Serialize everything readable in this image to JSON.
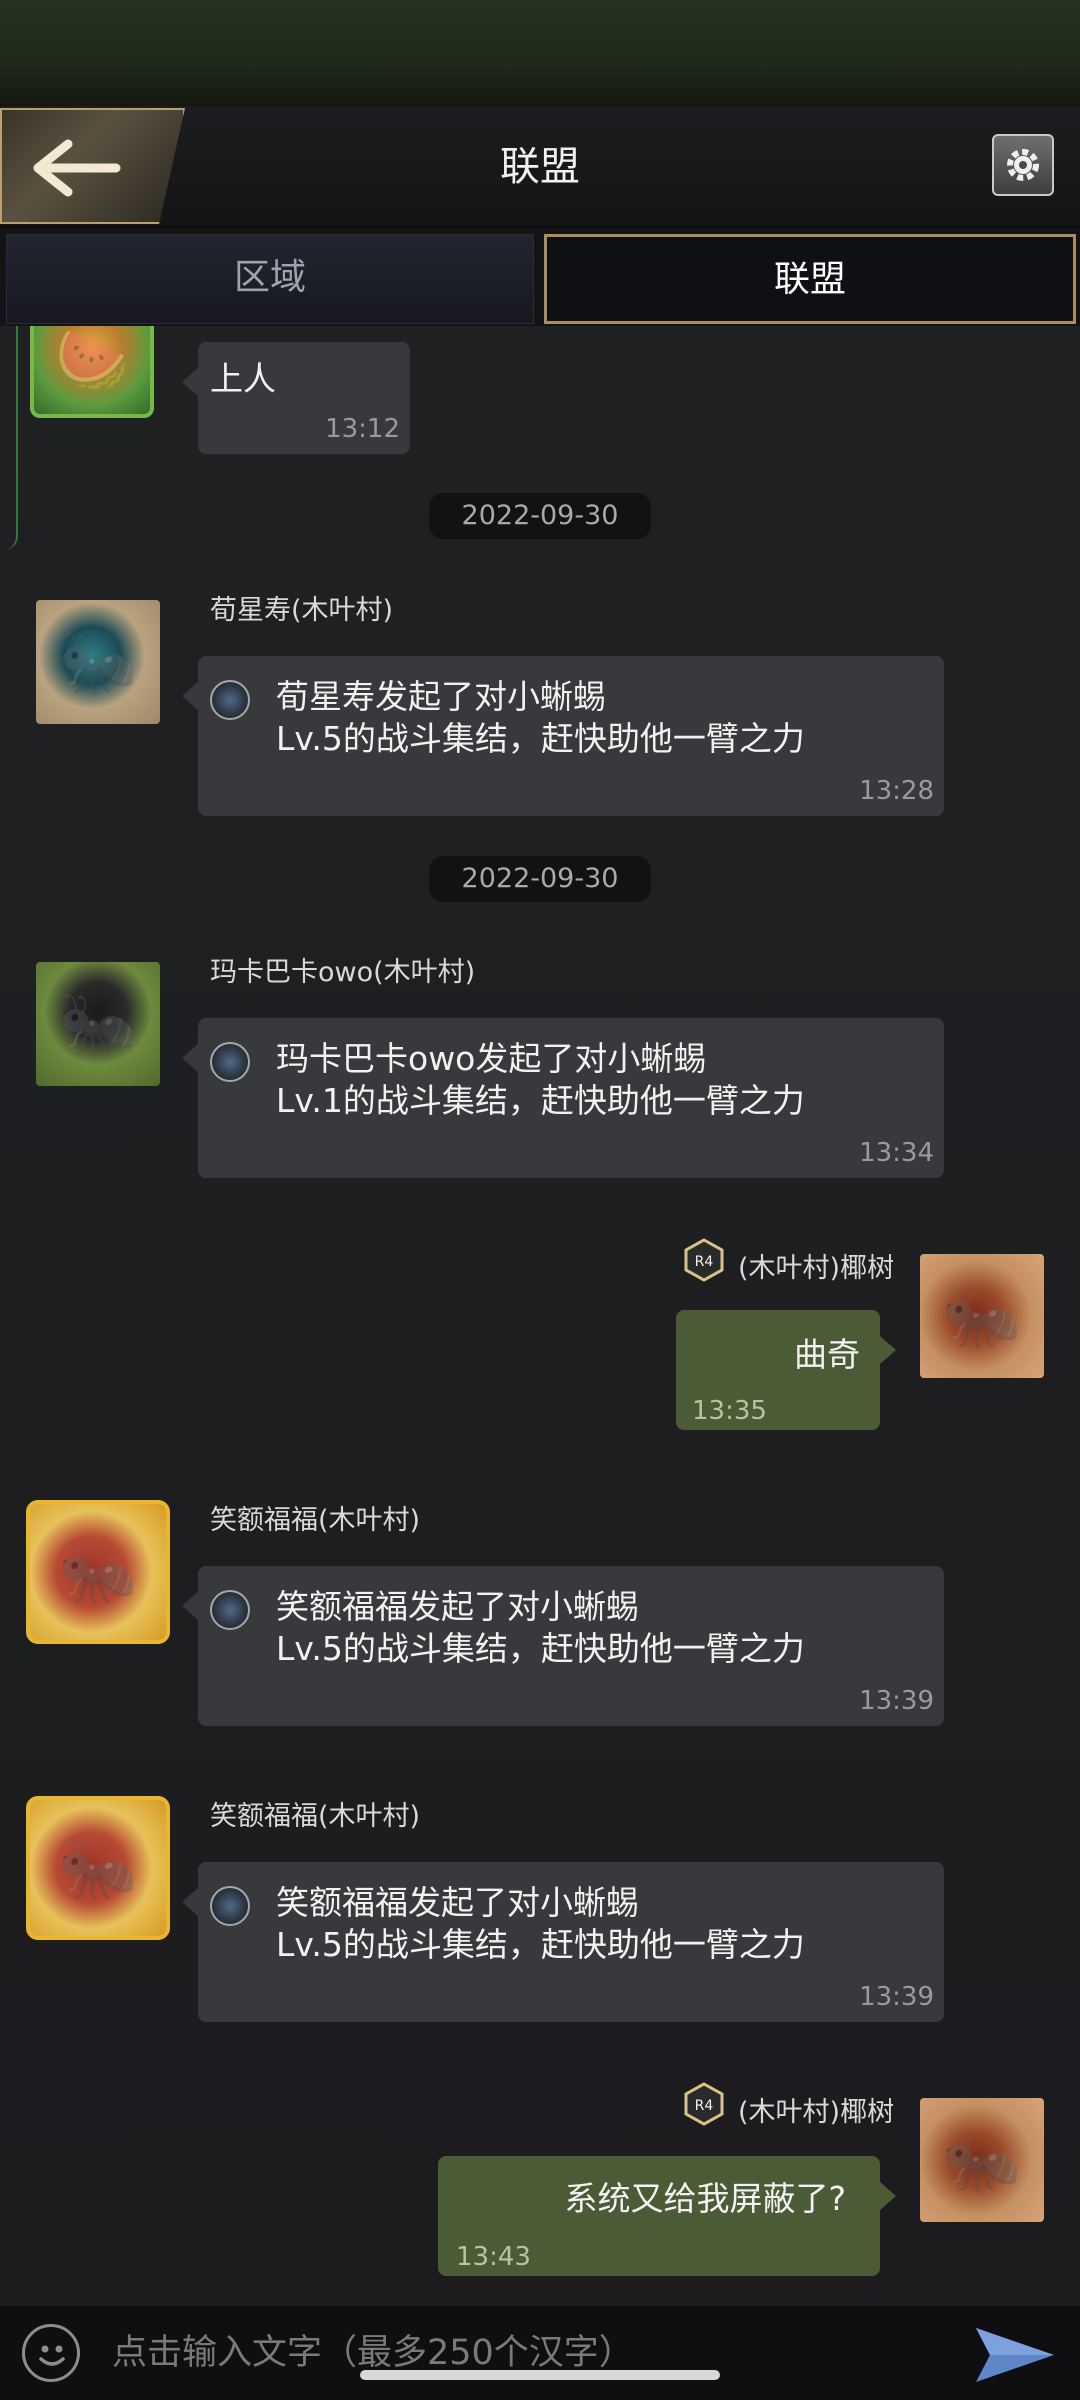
{
  "header": {
    "title": "联盟"
  },
  "tabs": [
    {
      "label": "区域",
      "active": false
    },
    {
      "label": "联盟",
      "active": true
    }
  ],
  "messages": [
    {
      "text": "上人",
      "time": "13:12"
    },
    {
      "date": "2022-09-30"
    },
    {
      "sender": "荀星寿(木叶村)",
      "line1": "荀星寿发起了对小蜥蜴",
      "line2": "Lv.5的战斗集结，赶快助他一臂之力",
      "time": "13:28"
    },
    {
      "date": "2022-09-30"
    },
    {
      "sender": "玛卡巴卡owo(木叶村)",
      "line1": "玛卡巴卡owo发起了对小蜥蜴",
      "line2": "Lv.1的战斗集结，赶快助他一臂之力",
      "time": "13:34"
    },
    {
      "sender": "(木叶村)椰树",
      "rank": "R4",
      "text": "曲奇",
      "time": "13:35"
    },
    {
      "sender": "笑额福福(木叶村)",
      "line1": "笑额福福发起了对小蜥蜴",
      "line2": "Lv.5的战斗集结，赶快助他一臂之力",
      "time": "13:39"
    },
    {
      "sender": "笑额福福(木叶村)",
      "line1": "笑额福福发起了对小蜥蜴",
      "line2": "Lv.5的战斗集结，赶快助他一臂之力",
      "time": "13:39"
    },
    {
      "sender": "(木叶村)椰树",
      "rank": "R4",
      "text": "系统又给我屏蔽了?",
      "time": "13:43"
    }
  ],
  "input": {
    "placeholder": "点击输入文字（最多250个汉字）"
  },
  "colors": {
    "accent_gold": "#a88f5c",
    "own_bubble": "#4a5b36",
    "other_bubble": "#38393c"
  },
  "icons": [
    "back-arrow-icon",
    "gear-icon",
    "emoji-icon",
    "send-icon",
    "rally-badge-icon",
    "r4-rank-icon"
  ]
}
